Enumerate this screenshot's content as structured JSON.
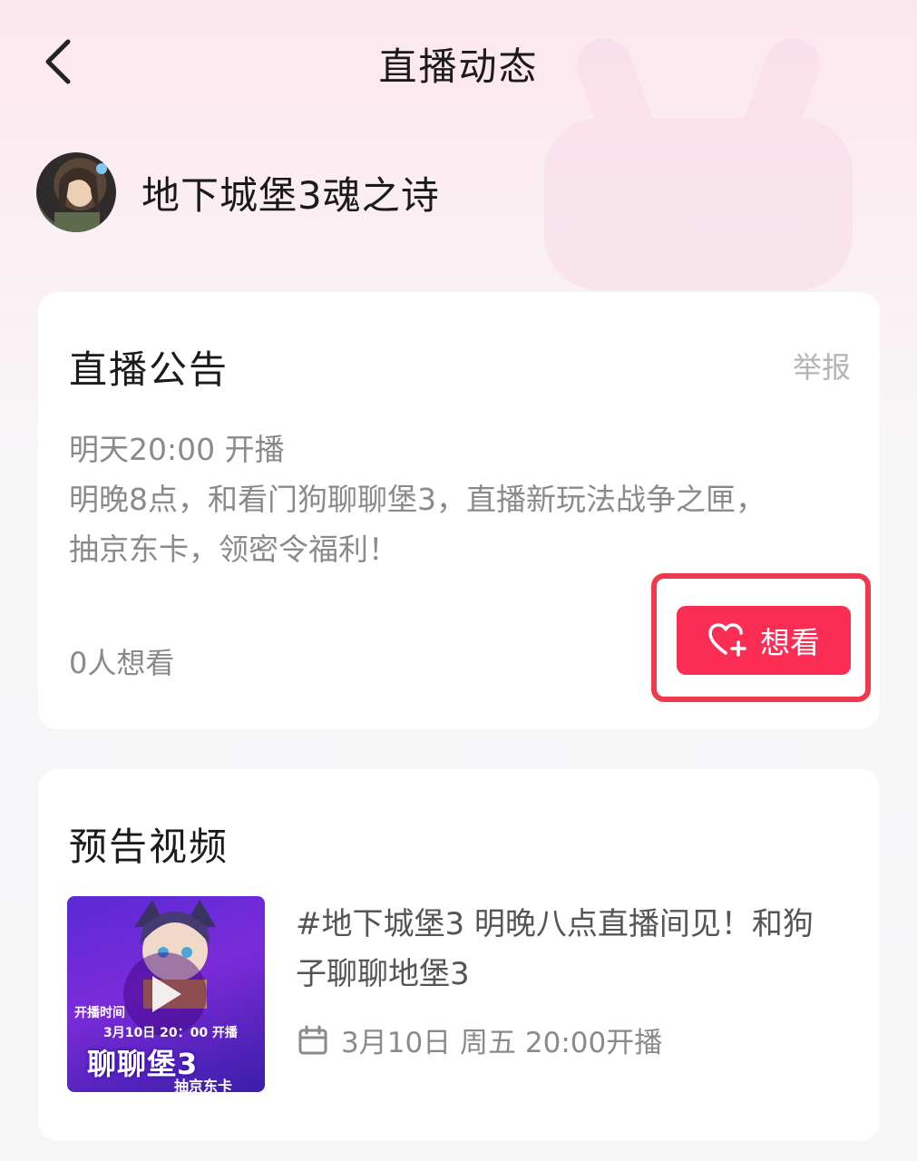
{
  "header": {
    "title": "直播动态"
  },
  "streamer": {
    "name": "地下城堡3魂之诗"
  },
  "announcement": {
    "title": "直播公告",
    "report_label": "举报",
    "lines": [
      "明天20:00 开播",
      "明晚8点，和看门狗聊聊堡3，直播新玩法战争之匣，",
      "抽京东卡，领密令福利！"
    ],
    "want_count": "0人想看",
    "want_button_label": "想看"
  },
  "preview": {
    "title": "预告视频",
    "video": {
      "title_line1": "#地下城堡3 明晚八点直播间见！和狗",
      "title_line2": "子聊聊地堡3",
      "time": "3月10日 周五 20:00开播",
      "thumb_text_top": "开播时间",
      "thumb_text_date": "3月10日 20：00 开播",
      "thumb_text_big": "聊聊堡3",
      "thumb_text_card": "抽京东卡"
    }
  },
  "colors": {
    "accent": "#fb2d55",
    "highlight": "#f0394b"
  }
}
